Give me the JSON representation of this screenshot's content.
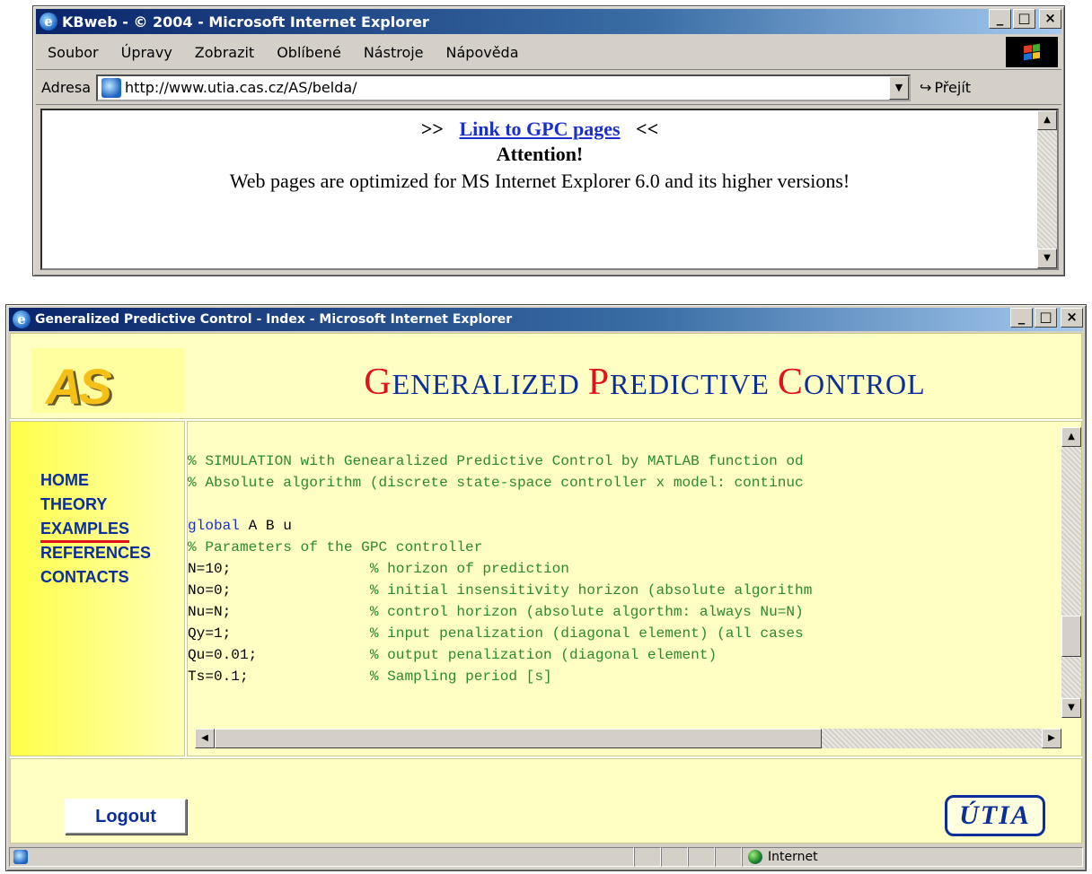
{
  "window1": {
    "title": "KBweb - © 2004 - Microsoft Internet Explorer",
    "menu": [
      "Soubor",
      "Úpravy",
      "Zobrazit",
      "Oblíbené",
      "Nástroje",
      "Nápověda"
    ],
    "address_label": "Adresa",
    "address_value": "http://www.utia.cas.cz/AS/belda/",
    "go_label": "Přejít",
    "content": {
      "link_prefix": ">>",
      "link_text": "Link to GPC pages",
      "link_suffix": "<<",
      "attention": "Attention!",
      "notice": "Web pages are optimized for MS Internet Explorer 6.0 and its higher versions!"
    }
  },
  "window2": {
    "title": "Generalized Predictive Control - Index - Microsoft Internet Explorer",
    "logo_text": "AS",
    "header": {
      "w1_initial": "G",
      "w1_rest": "ENERALIZED",
      "w2_initial": "P",
      "w2_rest": "REDICTIVE",
      "w3_initial": "C",
      "w3_rest": "ONTROL"
    },
    "nav": [
      "HOME",
      "THEORY",
      "EXAMPLES",
      "REFERENCES",
      "CONTACTS"
    ],
    "active_nav": "EXAMPLES",
    "code": {
      "line1": "% SIMULATION with Genearalized Predictive Control by MATLAB function od",
      "line2": "% Absolute algorithm (discrete state-space controller x model: continuc",
      "line4_kw": "global",
      "line4_rest": " A B u",
      "line5": "% Parameters of the GPC controller",
      "params": [
        {
          "code": "N=10;",
          "comment": "% horizon of prediction"
        },
        {
          "code": "No=0;",
          "comment": "% initial insensitivity horizon (absolute algorithm"
        },
        {
          "code": "Nu=N;",
          "comment": "% control horizon (absolute algorthm: always Nu=N)"
        },
        {
          "code": "Qy=1;",
          "comment": "% input penalization (diagonal element) (all cases"
        },
        {
          "code": "Qu=0.01;",
          "comment": "% output penalization (diagonal element)"
        },
        {
          "code": "Ts=0.1;",
          "comment": "% Sampling period [s]"
        }
      ]
    },
    "logout_label": "Logout",
    "utia_logo": "ÚTIA",
    "status_zone": "Internet"
  },
  "colors": {
    "title_blue": "#0a246a",
    "frame_yellow": "#ffffc4",
    "nav_blue": "#0b2f9a",
    "accent_red": "#e0131a",
    "comment_green": "#2c8a2c"
  }
}
